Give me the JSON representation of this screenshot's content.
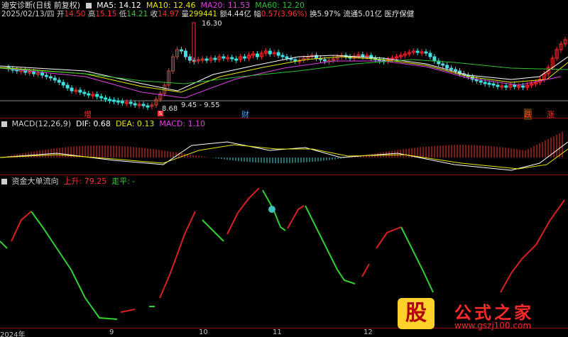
{
  "header": {
    "title": "迪安诊断(日线 前复权)",
    "ma": [
      {
        "label": "MA5: 14.12",
        "color": "#ffffff"
      },
      {
        "label": "MA10: 12.46",
        "color": "#e8e800"
      },
      {
        "label": "MA20: 11.53",
        "color": "#e040e0"
      },
      {
        "label": "MA60: 12.20",
        "color": "#30c030"
      }
    ],
    "date": "2025/02/13/四",
    "open_label": "开",
    "open": "14.50",
    "high_label": "高",
    "high": "15.15",
    "low_label": "低",
    "low": "14.21",
    "close_label": "收",
    "close": "14.97",
    "vol_label": "量",
    "vol": "299441",
    "amount_label": "额",
    "amount": "4.44亿",
    "chg_label": "幅",
    "chg": "0.57(3.96%)",
    "turnover": "换5.97%",
    "float": "流通5.01亿",
    "sector": "医疗保健"
  },
  "annotations": {
    "price_high": "16.30",
    "price_low": "8.68",
    "range": "9.45 - 9.55",
    "tag_zeng": "增",
    "tag_cai": "财",
    "tag_die": "跌",
    "tag_zhang": "涨",
    "tag_s": "S"
  },
  "macd": {
    "title": "MACD(12,26,9)",
    "dif_label": "DIF: 0.68",
    "dea_label": "DEA: 0.13",
    "macd_label": "MACD: 1.10"
  },
  "flow": {
    "title": "资金大单流向",
    "up_label": "上升: 79.25",
    "flat_label": "走平: -"
  },
  "xaxis": {
    "ticks": [
      {
        "label": "2024年"
      },
      {
        "label": "9"
      },
      {
        "label": "10"
      },
      {
        "label": "11"
      },
      {
        "label": "12"
      }
    ]
  },
  "watermark": {
    "logo_char": "股",
    "name": "公式之家",
    "url": "www.gszj100.com"
  },
  "colors": {
    "up": "#ff3030",
    "down": "#40e0e0",
    "ma5": "#ffffff",
    "ma10": "#e8e800",
    "ma20": "#e040e0",
    "ma60": "#30c030",
    "flow_up": "#d82020",
    "flow_down": "#30d030"
  }
}
